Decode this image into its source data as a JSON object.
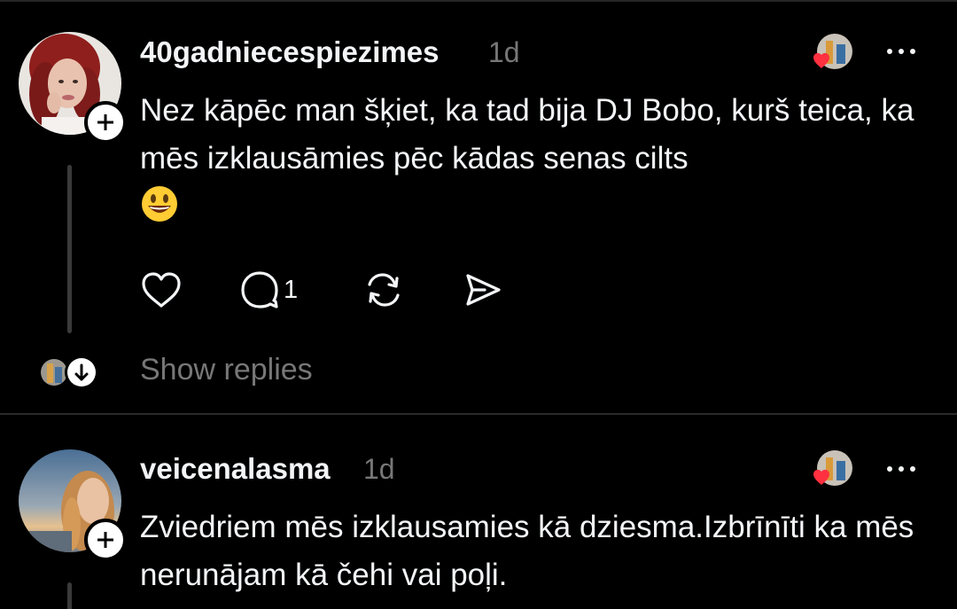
{
  "posts": [
    {
      "username": "40gadniecespiezimes",
      "time": "1d",
      "text": "Nez kāpēc man šķiet, ka tad bija DJ Bobo, kurš teica, ka mēs izklausāmies pēc kādas senas cilts",
      "emoji": "grinning-face",
      "reply_count": "1",
      "show_replies_label": "Show replies"
    },
    {
      "username": "veicenalasma",
      "time": "1d",
      "text": "Zviedriem mēs izklausamies kā dziesma.Izbrīnīti ka mēs nerunājam kā čehi vai poļi."
    }
  ],
  "colors": {
    "background": "#000000",
    "text": "#f3f5f7",
    "muted": "#777777",
    "like_heart": "#ff3040",
    "divider": "#2a2a2a"
  },
  "icons": [
    "heart-icon",
    "comment-icon",
    "repost-icon",
    "share-icon",
    "more-icon",
    "plus-icon",
    "arrow-down-icon"
  ]
}
